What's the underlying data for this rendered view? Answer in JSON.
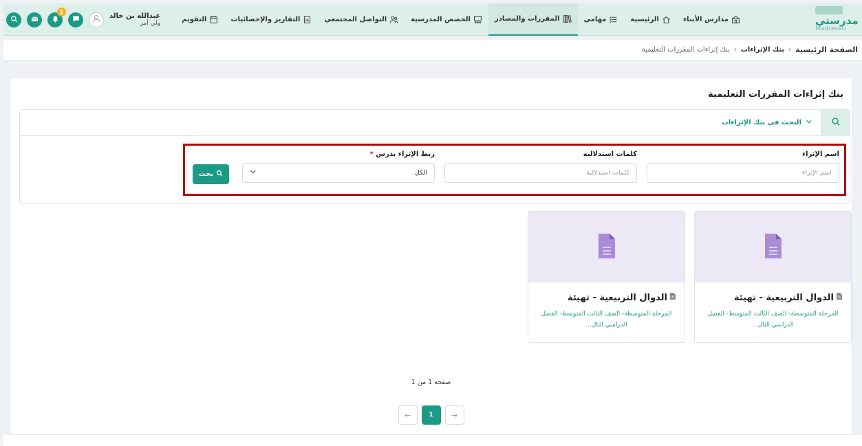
{
  "colors": {
    "brand": "#1c9a86",
    "nav_bg": "#dcefe8",
    "highlight_border": "#b5070b",
    "thumb_bg": "#ede8f6"
  },
  "logo": {
    "arabic": "مدرستي",
    "latin": "Madrasati"
  },
  "nav": [
    {
      "label": "مدارس الأبناء",
      "icon": "school-building-icon"
    },
    {
      "label": "الرئيسية",
      "icon": "home-icon"
    },
    {
      "label": "مهامي",
      "icon": "tasks-list-icon"
    },
    {
      "label": "المقررات والمصادر",
      "icon": "books-icon",
      "active": true
    },
    {
      "label": "الحصص المدرسية",
      "icon": "classroom-icon"
    },
    {
      "label": "التواصل المجتمعي",
      "icon": "community-icon"
    },
    {
      "label": "التقارير والإحصائيات",
      "icon": "report-icon"
    },
    {
      "label": "التقويم",
      "icon": "calendar-icon"
    }
  ],
  "user": {
    "name": "عبدالله بن خالد",
    "role": "ولي أمر",
    "notification_count": "1"
  },
  "breadcrumb": {
    "home": "الصفحة الرئيسية",
    "section": "بنك الإثراءات",
    "current": "بنك إثراءات المقررات التعليمية"
  },
  "page": {
    "title": "بنك إثراءات المقررات التعليمية"
  },
  "search": {
    "toggle_label": "البحث في بنك الإثراءات",
    "name_label": "اسم الإثراء",
    "name_placeholder": "اسم الإثراء",
    "keywords_label": "كلمات استدلالية",
    "keywords_placeholder": "كلمات استدلالية",
    "link_label": "ربط الإثراء بدرس",
    "link_required": "*",
    "link_value": "الكل",
    "button_label": "بحث"
  },
  "results": [
    {
      "title": "الدوال التربيعية - تهيئة",
      "description": "المرحلة المتوسطة- الصف الثالث المتوسط- الفصل الدراسي الثال..."
    },
    {
      "title": "الدوال التربيعية - تهيئة",
      "description": "المرحلة المتوسطة- الصف الثالث المتوسط- الفصل الدراسي الثال..."
    }
  ],
  "pagination": {
    "info": "صفحة 1 من 1",
    "prev": "←",
    "current": "1",
    "next": "→"
  }
}
